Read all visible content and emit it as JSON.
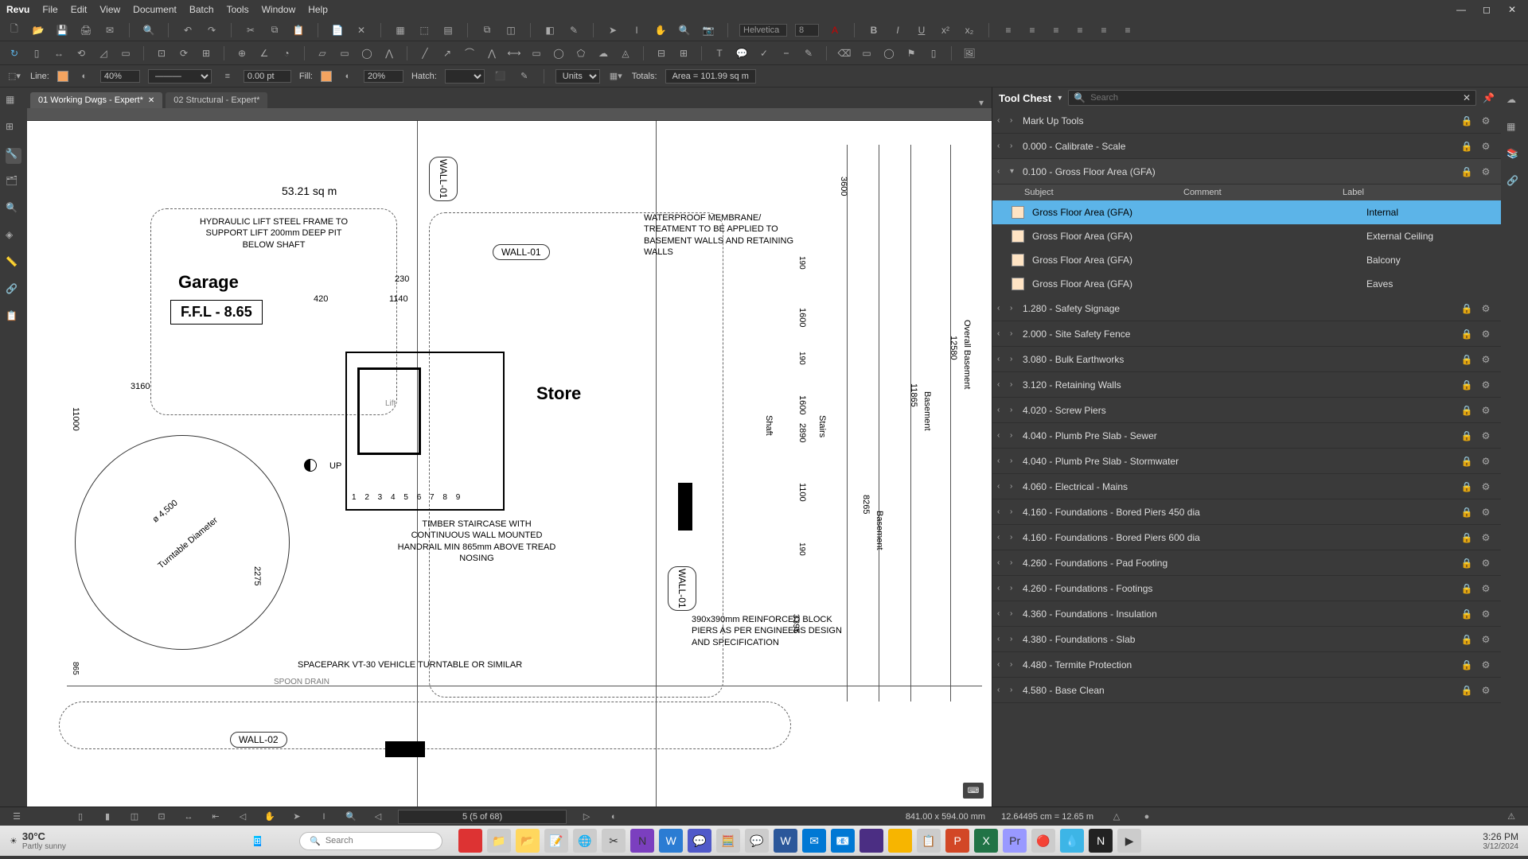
{
  "app": {
    "name": "Revu"
  },
  "menu": [
    "File",
    "Edit",
    "View",
    "Document",
    "Batch",
    "Tools",
    "Window",
    "Help"
  ],
  "toolbar": {
    "font": "Helvetica",
    "font_size": "8"
  },
  "properties": {
    "line_label": "Line:",
    "line_opacity": "40%",
    "width": "0.00 pt",
    "fill_label": "Fill:",
    "fill_opacity": "20%",
    "hatch_label": "Hatch:",
    "units_label": "Units",
    "totals_label": "Totals:",
    "totals_value": "Area = 101.99 sq m"
  },
  "tabs": [
    {
      "label": "01 Working Dwgs - Expert*",
      "active": true
    },
    {
      "label": "02 Structural - Expert*",
      "active": false
    }
  ],
  "drawing": {
    "area_text": "53.21 sq m",
    "garage": "Garage",
    "ffl": "F.F.L - 8.65",
    "store": "Store",
    "lift_note": "HYDRAULIC LIFT\nSTEEL FRAME TO SUPPORT LIFT\n200mm DEEP PIT BELOW SHAFT",
    "wall01": "WALL-01",
    "wall01b": "WALL-01",
    "wall01c": "WALL-01",
    "wall02": "WALL-02",
    "membrane_note": "WATERPROOF MEMBRANE/ TREATMENT\nTO BE APPLIED TO BASEMENT WALLS\nAND RETAINING WALLS",
    "stair_note": "TIMBER STAIRCASE WITH CONTINUOUS\nWALL MOUNTED HANDRAIL MIN\n865mm ABOVE TREAD NOSING",
    "turntable_note": "SPACEPARK VT-30 VEHICLE TURNTABLE OR SIMILAR",
    "turntable_dia": "Turntable Diameter",
    "dia_val": "ø 4,500",
    "block_note": "390x390mm\nREINFORCED BLOCK\nPIERS AS PER\nENGINEERS DESIGN\nAND SPECIFICATION",
    "dim_230": "230",
    "dim_1140": "1140",
    "dim_420": "420",
    "dim_3160": "3160",
    "dim_3600": "3600",
    "dim_190": "190",
    "dim_1600": "1600",
    "dim_2890": "2890",
    "dim_1100": "1100",
    "dim_11000": "11000",
    "dim_865": "865",
    "dim_11865": "11865",
    "dim_12580": "12580",
    "dim_8265": "8265",
    "dim_3395": "3395",
    "dim_2275": "2275",
    "shaft": "Shaft",
    "stairs": "Stairs",
    "lift": "Lift",
    "up": "UP",
    "basement": "Basement",
    "overall_basement": "Overall Basement",
    "spoon_drain": "SPOON DRAIN",
    "stair_nums": "1 2 3 4 5 6 7 8    9"
  },
  "tool_chest": {
    "title": "Tool Chest",
    "search_placeholder": "Search",
    "top_row": "Mark Up Tools",
    "sections": [
      {
        "label": "0.000 - Calibrate - Scale",
        "expanded": false
      },
      {
        "label": "0.100 - Gross Floor Area (GFA)",
        "expanded": true
      },
      {
        "label": "1.280 - Safety Signage"
      },
      {
        "label": "2.000 - Site Safety Fence"
      },
      {
        "label": "3.080 - Bulk Earthworks"
      },
      {
        "label": "3.120 - Retaining Walls"
      },
      {
        "label": "4.020 - Screw Piers"
      },
      {
        "label": "4.040 - Plumb Pre Slab - Sewer"
      },
      {
        "label": "4.040 - Plumb Pre Slab - Stormwater"
      },
      {
        "label": "4.060 - Electrical - Mains"
      },
      {
        "label": "4.160 - Foundations - Bored Piers 450 dia"
      },
      {
        "label": "4.160 - Foundations - Bored Piers 600 dia"
      },
      {
        "label": "4.260 - Foundations - Pad Footing"
      },
      {
        "label": "4.260 - Foundations - Footings"
      },
      {
        "label": "4.360 - Foundations - Insulation"
      },
      {
        "label": "4.380 - Foundations - Slab"
      },
      {
        "label": "4.480 - Termite Protection"
      },
      {
        "label": "4.580 - Base Clean"
      }
    ],
    "columns": {
      "subject": "Subject",
      "comment": "Comment",
      "label": "Label"
    },
    "gfa_items": [
      {
        "subject": "Gross Floor Area (GFA)",
        "comment": "",
        "label": "Internal",
        "selected": true
      },
      {
        "subject": "Gross Floor Area (GFA)",
        "comment": "",
        "label": "External Ceiling"
      },
      {
        "subject": "Gross Floor Area (GFA)",
        "comment": "",
        "label": "Balcony"
      },
      {
        "subject": "Gross Floor Area (GFA)",
        "comment": "",
        "label": "Eaves"
      }
    ]
  },
  "status": {
    "page": "5 (5 of 68)",
    "size": "841.00 x 594.00 mm",
    "dist": "12.64495 cm = 12.65 m"
  },
  "taskbar": {
    "temp": "30°C",
    "weather": "Partly sunny",
    "search_placeholder": "Search",
    "time": "3:26 PM",
    "date": "3/12/2024"
  }
}
